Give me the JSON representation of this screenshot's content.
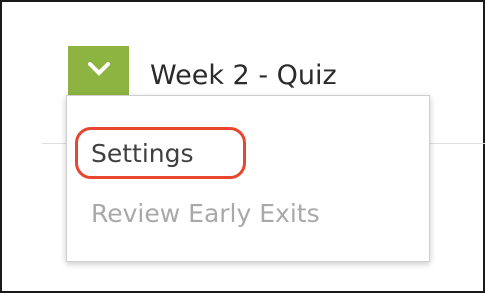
{
  "header": {
    "title": "Week 2 - Quiz",
    "toggle_icon": "chevron-down-icon",
    "toggle_color": "#8db340"
  },
  "menu": {
    "items": [
      {
        "label": "Settings",
        "state": "enabled",
        "highlighted": true
      },
      {
        "label": "Review Early Exits",
        "state": "disabled",
        "highlighted": false
      }
    ]
  },
  "colors": {
    "highlight": "#e8462e",
    "text": "#2b2b2b",
    "disabled_text": "#a9a9a9"
  }
}
